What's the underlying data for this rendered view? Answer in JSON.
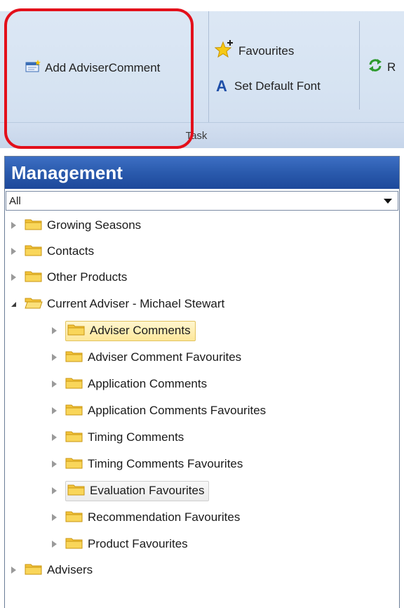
{
  "ribbon": {
    "add_adviser_comment": "Add AdviserComment",
    "favourites": "Favourites",
    "set_default_font": "Set Default Font",
    "group_label": "Task",
    "refresh_partial": "R"
  },
  "panel": {
    "title": "Management",
    "filter_value": "All"
  },
  "tree": {
    "growing_seasons": "Growing Seasons",
    "contacts": "Contacts",
    "other_products": "Other Products",
    "current_adviser": "Current Adviser - Michael Stewart",
    "children": {
      "adviser_comments": "Adviser Comments",
      "adviser_comment_favourites": "Adviser Comment Favourites",
      "application_comments": "Application Comments",
      "application_comments_favourites": "Application Comments Favourites",
      "timing_comments": "Timing Comments",
      "timing_comments_favourites": "Timing Comments Favourites",
      "evaluation_favourites": "Evaluation Favourites",
      "recommendation_favourites": "Recommendation Favourites",
      "product_favourites": "Product Favourites"
    },
    "advisers": "Advisers"
  },
  "colors": {
    "highlight_ring": "#e3101b",
    "panel_header": "#2a5aad",
    "folder": "#f2c12e",
    "selection": "#fde79a"
  }
}
